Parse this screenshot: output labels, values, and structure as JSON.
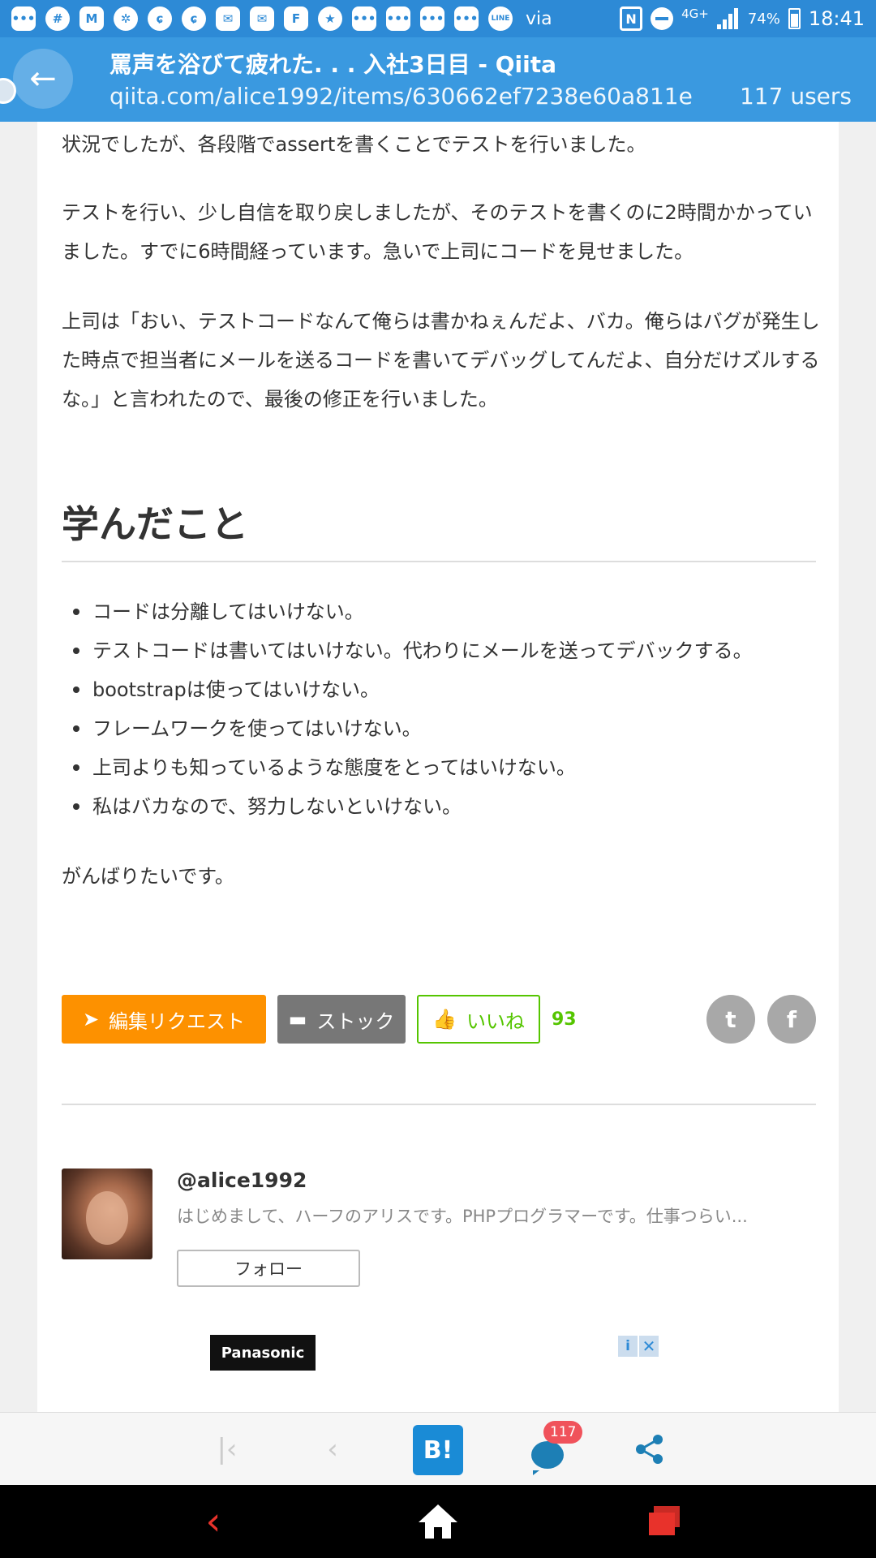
{
  "status_bar": {
    "via": "via",
    "network": "4G+",
    "battery": "74%",
    "time": "18:41"
  },
  "header": {
    "title": "罵声を浴びて疲れた. . . 入社3日目 - Qiita",
    "url": "qiita.com/alice1992/items/630662ef7238e60a811e",
    "users": "117 users"
  },
  "article": {
    "para1": "状況でしたが、各段階でassertを書くことでテストを行いました。",
    "para2": "テストを行い、少し自信を取り戻しましたが、そのテストを書くのに2時間かかっていました。すでに6時間経っています。急いで上司にコードを見せました。",
    "para3": "上司は「おい、テストコードなんて俺らは書かねぇんだよ、バカ。俺らはバグが発生した時点で担当者にメールを送るコードを書いてデバッグしてんだよ、自分だけズルするな。」と言われたので、最後の修正を行いました。",
    "heading": "学んだこと",
    "bullets": [
      "コードは分離してはいけない。",
      "テストコードは書いてはいけない。代わりにメールを送ってデバックする。",
      "bootstrapは使ってはいけない。",
      "フレームワークを使ってはいけない。",
      "上司よりも知っているような態度をとってはいけない。",
      "私はバカなので、努力しないといけない。"
    ],
    "closing": "がんばりたいです。"
  },
  "actions": {
    "edit_request": "編集リクエスト",
    "stock": "ストック",
    "like": "いいね",
    "like_count": "93"
  },
  "author": {
    "username": "@alice1992",
    "bio": "はじめまして、ハーフのアリスです。PHPプログラマーです。仕事つらい...",
    "follow": "フォロー"
  },
  "ad": {
    "brand": "Panasonic"
  },
  "toolbar": {
    "hatena": "B!",
    "comment_count": "117"
  },
  "colors": {
    "status_bar": "#2d8ad6",
    "title_bar": "#3a99e0",
    "edit_button": "#fd9100",
    "stock_button": "#777777",
    "like_green": "#55c500",
    "nav_back": "#e8322b"
  }
}
